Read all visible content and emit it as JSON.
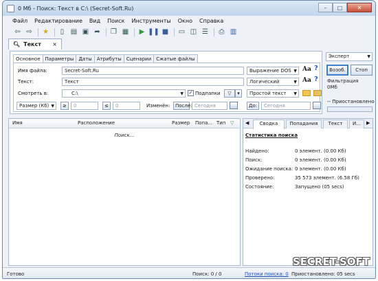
{
  "window": {
    "title": "0 Мб - Поиск: Текст в C:\\ (Secret-Soft.Ru)",
    "buttons": {
      "minimize": "–",
      "maximize": "□",
      "close": "✕"
    }
  },
  "menu": [
    "Файл",
    "Редактирование",
    "Вид",
    "Поиск",
    "Инструменты",
    "Окно",
    "Справка"
  ],
  "toolbar_icons": [
    "back-icon",
    "forward-icon",
    "star-icon",
    "new-icon",
    "open-icon",
    "save-icon",
    "export-icon",
    "copy-icon",
    "paste-icon",
    "play-icon",
    "pause-icon",
    "stop-icon",
    "window-icon",
    "split-icon",
    "list-icon",
    "print-icon",
    "book-icon"
  ],
  "doc_tab": {
    "label": "Текст",
    "close": "×"
  },
  "criteria_tabs": [
    "Основное",
    "Параметры",
    "Даты",
    "Атрибуты",
    "Сценарии",
    "Сжатые файлы"
  ],
  "form": {
    "filename_label": "Имя файла:",
    "filename_value": "Secret-Soft.Ru",
    "filename_mode": "Выражение DOS",
    "text_label": "Текст:",
    "text_value": "Текст",
    "text_mode": "Логический",
    "lookin_label": "Смотреть в:",
    "lookin_value": "C:\\",
    "subfolders_label": "Подпапки",
    "subfolders_checked": true,
    "text_type": "Простой текст",
    "size_unit": "Размер (Кб)",
    "ge_symbol": "≥",
    "size_min": "0",
    "le_symbol": "≤",
    "size_max": "0",
    "modified_label": "Изменён:",
    "after_label": "После:",
    "after_value": "Сегодня",
    "before_label": "До:",
    "before_value": "Сегодня",
    "aa": "Aa",
    "help": "?"
  },
  "right_panel": {
    "mode": "Эксперт",
    "start_button": "Возоб.",
    "stop_button": "Стоп",
    "filter_label": "Фильтрация",
    "filter_value": "0Мб",
    "paused_label": "Приостановлено"
  },
  "results": {
    "columns": [
      "Имя",
      "Расположение",
      "Размер",
      "Попа...",
      "Тип"
    ],
    "placeholder": "Поиск..."
  },
  "stats": {
    "tabs": [
      "Сводка",
      "Попадания",
      "Текст",
      "И..."
    ],
    "title": "Статистика поиска",
    "rows": [
      {
        "key": "Найдено:",
        "value": "0 элемент. (0.00 Кб)"
      },
      {
        "key": "Поиск:",
        "value": "0 элемент. (0.00 Кб)"
      },
      {
        "key": "Ожидание поиска:",
        "value": "0 элемент. (0.00 Кб)"
      },
      {
        "key": "Проверено:",
        "value": "35 573 элемент. (6.58 Гб)"
      },
      {
        "key": "Состояние:",
        "value": "Запущено (05 secs)"
      }
    ]
  },
  "statusbar": {
    "ready": "Готово",
    "search_count": "Поиск: 0 / 0",
    "threads_link": "Потоки поиска: 0",
    "paused": "Приостановлено: 05 secs"
  },
  "watermark": "SECRET-SOFT"
}
